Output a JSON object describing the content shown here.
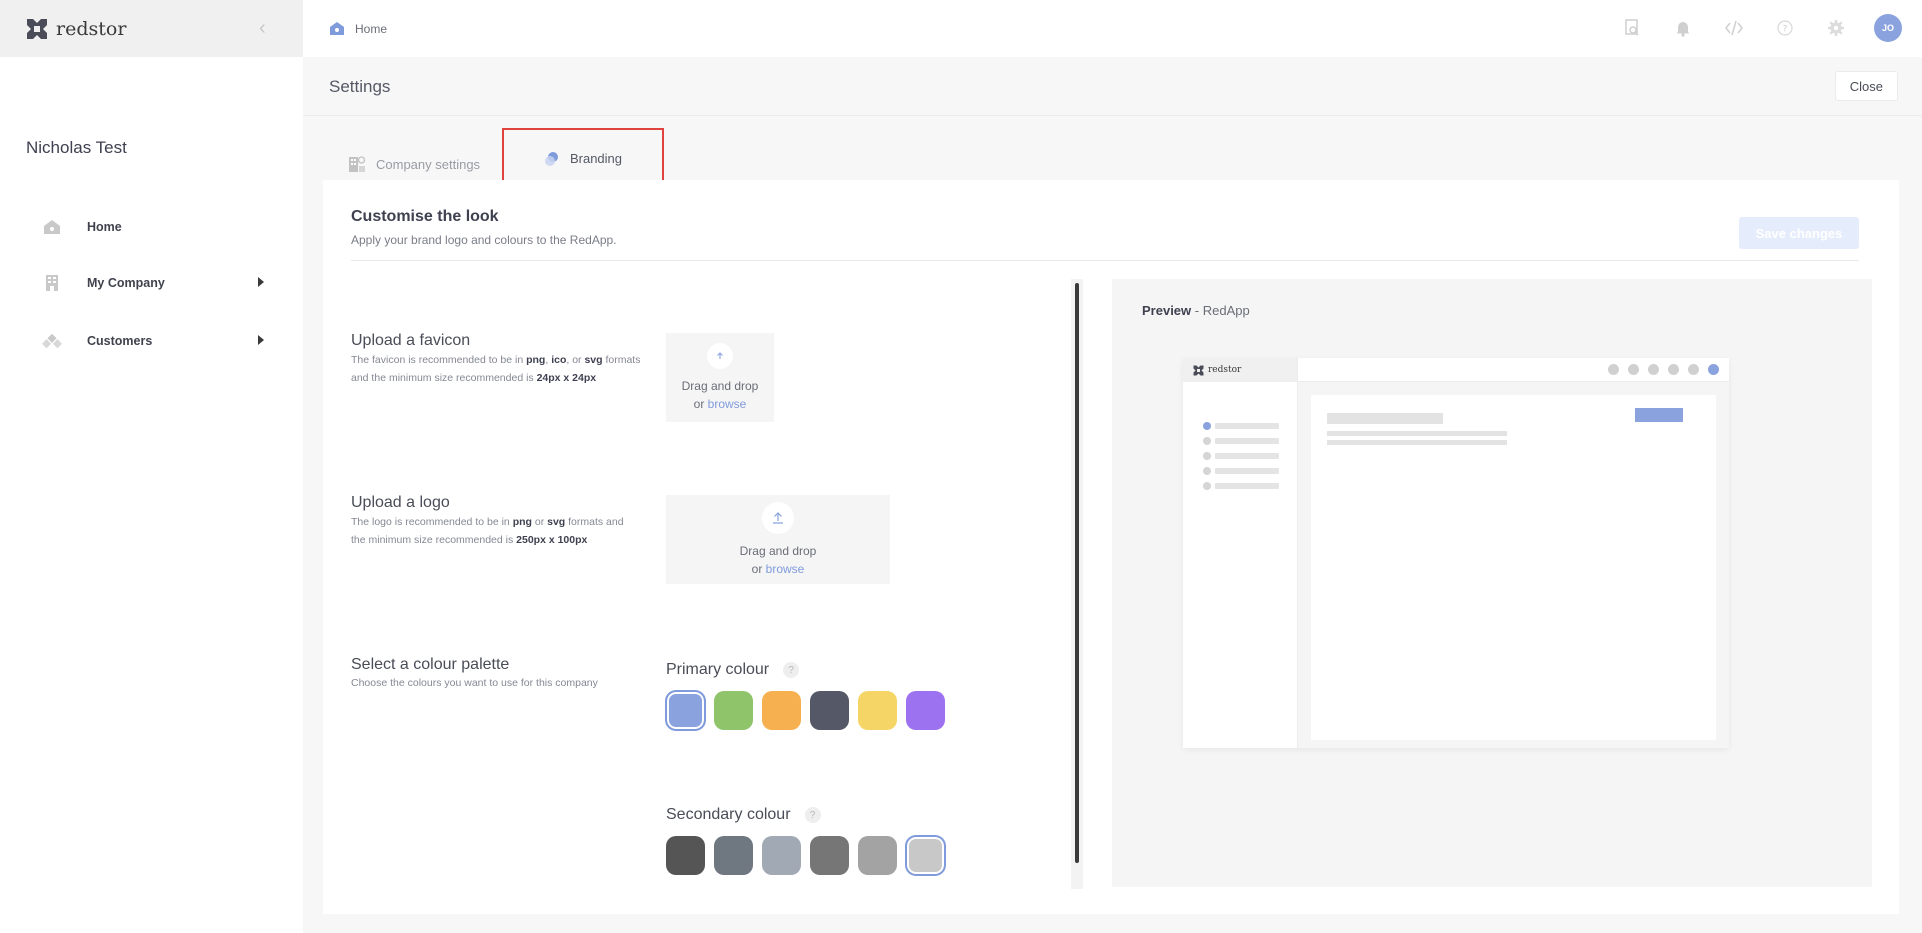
{
  "sidebar": {
    "brand": "redstor",
    "company_name": "Nicholas Test",
    "items": [
      {
        "label": "Home",
        "icon": "home-icon"
      },
      {
        "label": "My Company",
        "icon": "building-icon"
      },
      {
        "label": "Customers",
        "icon": "customers-icon"
      }
    ]
  },
  "topbar": {
    "breadcrumb": "Home",
    "avatar_initials": "JO",
    "icons": [
      "search-document-icon",
      "bell-icon",
      "code-icon",
      "help-icon",
      "gear-icon"
    ]
  },
  "settings": {
    "title": "Settings",
    "close_label": "Close"
  },
  "tabs": [
    {
      "label": "Company settings",
      "icon": "company-settings-icon"
    },
    {
      "label": "Branding",
      "icon": "branding-icon"
    }
  ],
  "branding": {
    "title": "Customise the look",
    "subtitle": "Apply your brand logo and colours to the RedApp.",
    "save_label": "Save changes",
    "favicon": {
      "title": "Upload a favicon",
      "desc_1": "The favicon is recommended to be in ",
      "fmt_1": "png",
      "sep_1": ", ",
      "fmt_2": "ico",
      "sep_2": ", or ",
      "fmt_3": "svg",
      "desc_2": " formats and the minimum size recommended is ",
      "size": "24px x 24px",
      "drop_text": "Drag and drop",
      "or": "or ",
      "browse": "browse"
    },
    "logo": {
      "title": "Upload a logo",
      "desc_1": "The logo is recommended to be in ",
      "fmt_1": "png",
      "sep_1": " or ",
      "fmt_2": "svg",
      "desc_2": " formats and the minimum size recommended is ",
      "size": "250px x 100px",
      "drop_text": "Drag and drop",
      "or": "or ",
      "browse": "browse"
    },
    "palette": {
      "title": "Select a colour palette",
      "desc": "Choose the colours you want to use for this company",
      "primary_label": "Primary colour",
      "secondary_label": "Secondary colour",
      "help": "?",
      "primary": [
        "#8aa2dd",
        "#8fc46b",
        "#f6b04f",
        "#555866",
        "#f5d565",
        "#9c72f0"
      ],
      "primary_selected": 0,
      "secondary": [
        "#555555",
        "#6f7780",
        "#a1aab4",
        "#767676",
        "#a3a3a3",
        "#c8c8c8"
      ],
      "secondary_selected": 5
    }
  },
  "preview": {
    "label": "Preview",
    "sep": " - ",
    "app": "RedApp",
    "brand": "redstor"
  }
}
